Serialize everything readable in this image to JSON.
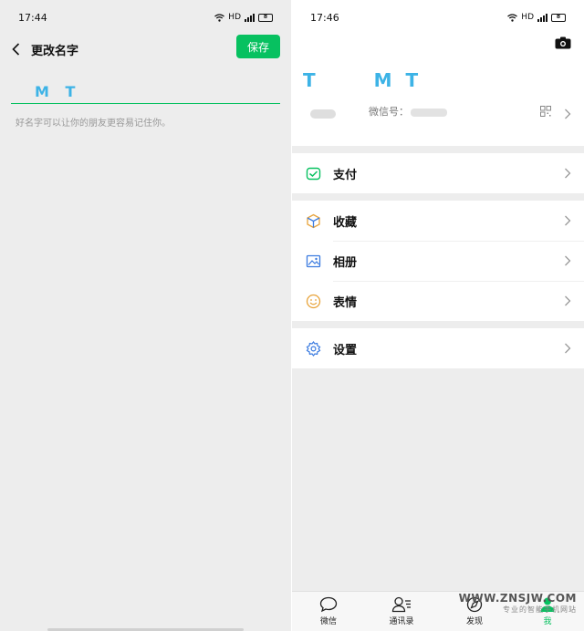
{
  "left": {
    "status": {
      "time": "17:44",
      "network": "HD"
    },
    "nav": {
      "title": "更改名字",
      "save_label": "保存"
    },
    "name_value": "M T",
    "hint": "好名字可以让你的朋友更容易记住你。"
  },
  "right": {
    "status": {
      "time": "17:46",
      "network": "HD"
    },
    "profile": {
      "name_left": "T",
      "name_right": "M T",
      "wechat_id_label": "微信号："
    },
    "menu": [
      {
        "label": "支付",
        "icon": "pay-icon"
      },
      {
        "label": "收藏",
        "icon": "favorites-icon"
      },
      {
        "label": "相册",
        "icon": "album-icon"
      },
      {
        "label": "表情",
        "icon": "sticker-icon"
      },
      {
        "label": "设置",
        "icon": "settings-icon"
      }
    ],
    "tabs": [
      {
        "label": "微信",
        "icon": "chat-icon"
      },
      {
        "label": "通讯录",
        "icon": "contacts-icon"
      },
      {
        "label": "发现",
        "icon": "discover-icon"
      },
      {
        "label": "我",
        "icon": "me-icon"
      }
    ]
  },
  "watermark": {
    "line1": "WWW.ZNSJW.COM",
    "line2": "专业的智能手机网站"
  },
  "colors": {
    "accent": "#07c160",
    "name_blue": "#3db3e6",
    "background": "#ededed"
  }
}
